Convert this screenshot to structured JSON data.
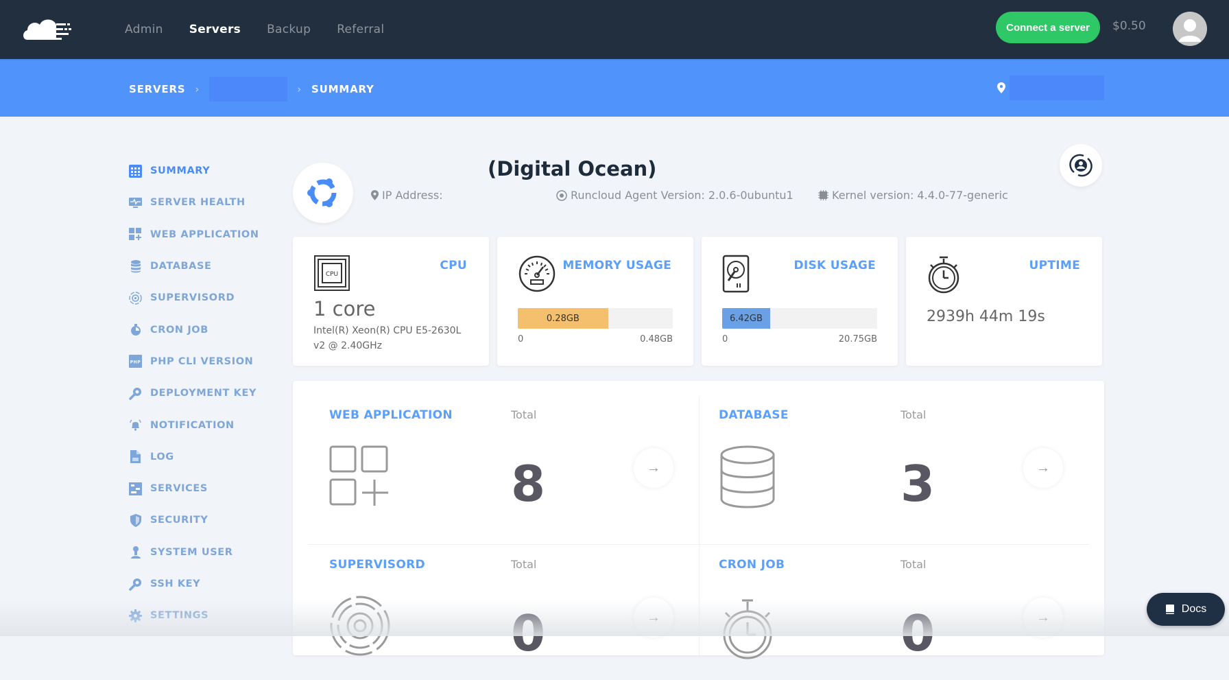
{
  "topbar": {
    "nav": [
      {
        "label": "Admin",
        "active": false
      },
      {
        "label": "Servers",
        "active": true
      },
      {
        "label": "Backup",
        "active": false
      },
      {
        "label": "Referral",
        "active": false
      }
    ],
    "connect_label": "Connect a server",
    "balance": "$0.50"
  },
  "breadcrumb": {
    "root": "SERVERS",
    "separator": "›",
    "current": "SUMMARY"
  },
  "sidebar": {
    "items": [
      {
        "label": "SUMMARY",
        "icon": "summary-grid-icon",
        "active": true
      },
      {
        "label": "SERVER HEALTH",
        "icon": "monitor-pulse-icon"
      },
      {
        "label": "WEB APPLICATION",
        "icon": "apps-grid-icon"
      },
      {
        "label": "DATABASE",
        "icon": "database-icon"
      },
      {
        "label": "SUPERVISORD",
        "icon": "gear-ring-icon"
      },
      {
        "label": "CRON JOB",
        "icon": "stopwatch-icon"
      },
      {
        "label": "PHP CLI VERSION",
        "icon": "php-icon"
      },
      {
        "label": "DEPLOYMENT KEY",
        "icon": "key-icon"
      },
      {
        "label": "NOTIFICATION",
        "icon": "bell-icon"
      },
      {
        "label": "LOG",
        "icon": "file-icon"
      },
      {
        "label": "SERVICES",
        "icon": "services-icon"
      },
      {
        "label": "SECURITY",
        "icon": "shield-icon"
      },
      {
        "label": "SYSTEM USER",
        "icon": "user-icon"
      },
      {
        "label": "SSH KEY",
        "icon": "key-icon"
      },
      {
        "label": "SETTINGS",
        "icon": "gear-icon"
      }
    ]
  },
  "server": {
    "name": "(Digital Ocean)",
    "ip_label": "IP Address:",
    "agent_version": "Runcloud Agent Version: 2.0.6-0ubuntu1",
    "kernel_version": "Kernel version: 4.4.0-77-generic"
  },
  "stats": {
    "cpu": {
      "title": "CPU",
      "cores": "1 core",
      "model": "Intel(R) Xeon(R) CPU E5-2630L v2 @ 2.40GHz"
    },
    "memory": {
      "title": "MEMORY USAGE",
      "used": "0.28GB",
      "min": "0",
      "max": "0.48GB",
      "fraction": 0.583,
      "color": "#f4c06d"
    },
    "disk": {
      "title": "DISK USAGE",
      "used": "6.42GB",
      "min": "0",
      "max": "20.75GB",
      "fraction": 0.309,
      "color": "#6aa0e6"
    },
    "uptime": {
      "title": "UPTIME",
      "value": "2939h 44m 19s"
    }
  },
  "summary": {
    "total_label": "Total",
    "cells": [
      {
        "title": "WEB APPLICATION",
        "count": "8"
      },
      {
        "title": "DATABASE",
        "count": "3"
      },
      {
        "title": "SUPERVISORD",
        "count": "0"
      },
      {
        "title": "CRON JOB",
        "count": "0"
      }
    ]
  },
  "docs_label": "Docs",
  "colors": {
    "accent": "#5093fb",
    "topbar": "#222f3e",
    "success": "#2ec866"
  }
}
